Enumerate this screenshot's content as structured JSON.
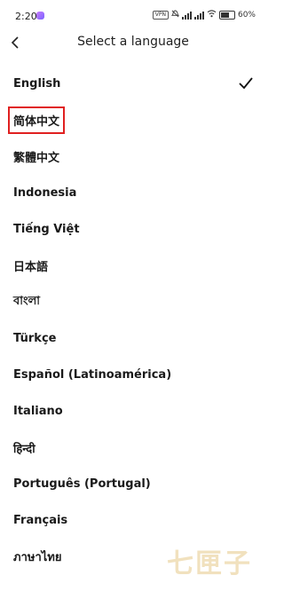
{
  "status_bar": {
    "time": "2:20",
    "vpn_label": "VPN",
    "battery_text": "60%"
  },
  "header": {
    "title": "Select a language",
    "back_icon": "chevron-left-icon"
  },
  "languages": [
    {
      "label": "English",
      "selected": true
    },
    {
      "label": "简体中文",
      "selected": false,
      "highlighted": true
    },
    {
      "label": "繁體中文",
      "selected": false
    },
    {
      "label": "Indonesia",
      "selected": false
    },
    {
      "label": "Tiếng Việt",
      "selected": false
    },
    {
      "label": "日本語",
      "selected": false
    },
    {
      "label": "বাংলা",
      "selected": false
    },
    {
      "label": "Türkçe",
      "selected": false
    },
    {
      "label": "Español (Latinoamérica)",
      "selected": false
    },
    {
      "label": "Italiano",
      "selected": false
    },
    {
      "label": "हिन्दी",
      "selected": false
    },
    {
      "label": "Português (Portugal)",
      "selected": false
    },
    {
      "label": "Français",
      "selected": false
    },
    {
      "label": "ภาษาไทย",
      "selected": false
    }
  ],
  "watermark_text": "七匣子",
  "colors": {
    "highlight_border": "#e02020",
    "text": "#1a1a1a"
  }
}
